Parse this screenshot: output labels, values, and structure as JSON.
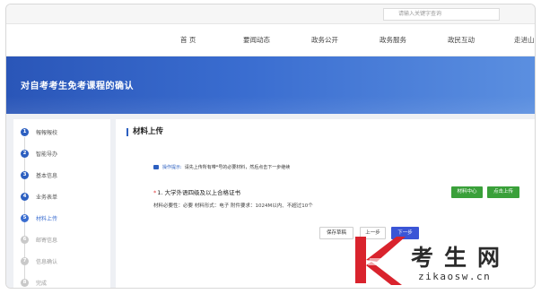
{
  "search": {
    "placeholder": "请输入关键字查询"
  },
  "nav": {
    "items": [
      {
        "label": "首  页"
      },
      {
        "label": "要闻动态"
      },
      {
        "label": "政务公开"
      },
      {
        "label": "政务服务"
      },
      {
        "label": "政民互动"
      },
      {
        "label": "走进山"
      }
    ]
  },
  "banner": {
    "title": "对自考考生免考课程的确认"
  },
  "sidebar": {
    "steps": [
      {
        "num": "1",
        "label": "報報報校",
        "state": "done"
      },
      {
        "num": "2",
        "label": "智能导办",
        "state": "done"
      },
      {
        "num": "3",
        "label": "基本信息",
        "state": "done"
      },
      {
        "num": "4",
        "label": "业务表单",
        "state": "done"
      },
      {
        "num": "5",
        "label": "材料上传",
        "state": "current"
      },
      {
        "num": "6",
        "label": "邮寄信息",
        "state": "pending"
      },
      {
        "num": "7",
        "label": "信息确认",
        "state": "pending"
      },
      {
        "num": "8",
        "label": "完成",
        "state": "pending"
      }
    ]
  },
  "main": {
    "title": "材料上传",
    "tip": {
      "label": "操作提示:",
      "text": "请先上传所有带*号的必要材料，然后点击下一步继续"
    },
    "requirement": {
      "star": "*",
      "title": "1. 大学外语四级及以上合格证书",
      "desc": "材料必要性：必要  材料形式：电子  附件要求：1024M以内、不超过10个"
    },
    "buttons": {
      "material_center": "材料中心",
      "upload": "点击上传",
      "save_draft": "保存草稿",
      "prev": "上一步",
      "next": "下一步"
    }
  },
  "watermark": {
    "chars": "考生网",
    "url": "zikaosw.cn"
  },
  "colors": {
    "brand_blue": "#2c5fc0",
    "green": "#3aa03a",
    "next_blue": "#3a55d6",
    "watermark_red": "#d9232d"
  }
}
